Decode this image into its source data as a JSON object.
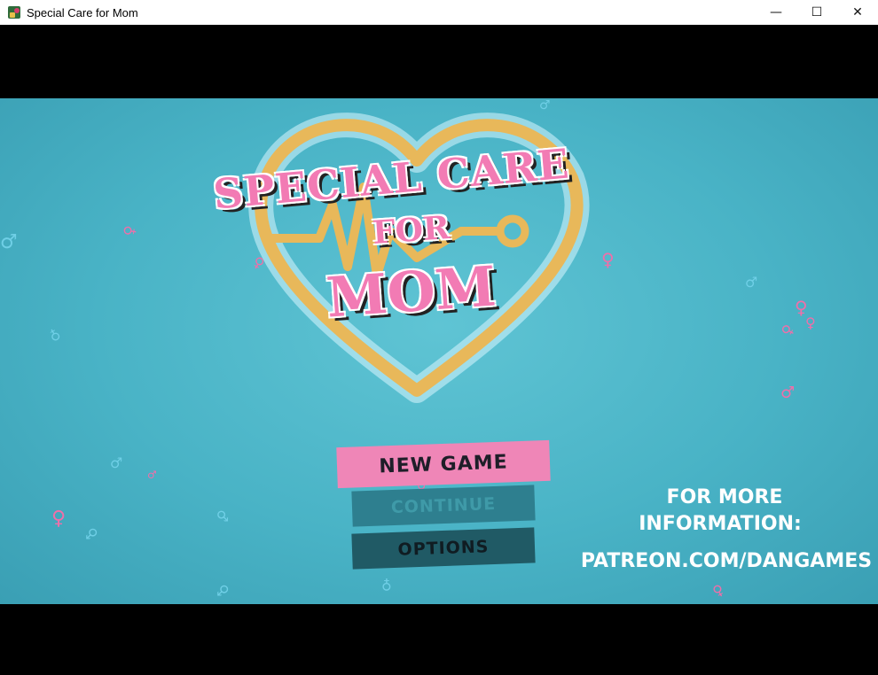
{
  "window": {
    "title": "Special Care for Mom",
    "minimize_glyph": "—",
    "maximize_glyph": "☐",
    "close_glyph": "✕"
  },
  "logo": {
    "line1": "SPECIAL CARE",
    "line2": "FOR",
    "line3": "MOM"
  },
  "menu": {
    "new_game": "NEW GAME",
    "continue": "CONTINUE",
    "options": "OPTIONS"
  },
  "info": {
    "line1": "FOR MORE",
    "line2": "INFORMATION:",
    "line3": "PATREON.COM/DANGAMES"
  },
  "colors": {
    "background": "#49b3c6",
    "logo_pink": "#f27bb4",
    "heart_gold": "#e8b85a",
    "new_game_bg": "#ef86b7",
    "continue_bg": "#2e7f8f",
    "options_bg": "#205a65"
  },
  "decor": {
    "female_symbol": "♀",
    "male_symbol": "♂"
  }
}
